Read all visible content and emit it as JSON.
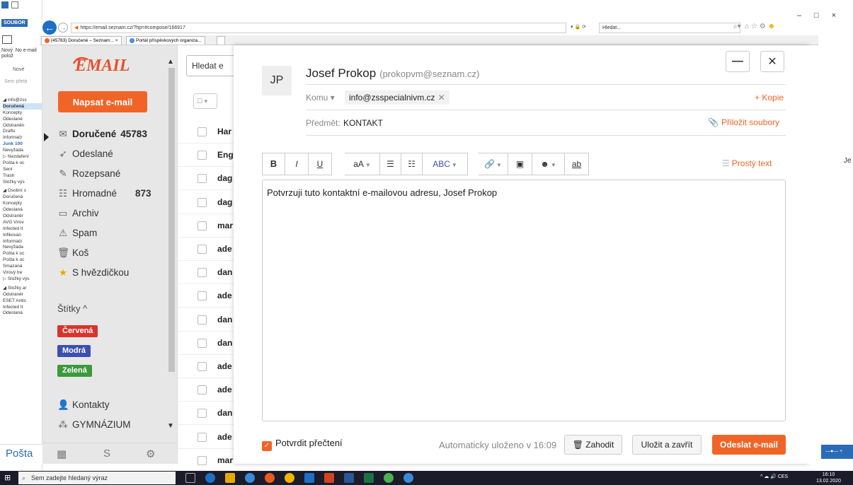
{
  "outlook": {
    "ribbon_tab": "SOUBOR",
    "new_label": "Nový  No e-mail polož",
    "new_category": "Nové",
    "search_hint": "Sem přetá",
    "folders": [
      {
        "label": "◢ info@zss",
        "kind": "acc"
      },
      {
        "label": "Doručená",
        "kind": "sel"
      },
      {
        "label": "Koncepty",
        "kind": ""
      },
      {
        "label": "Odeslané",
        "kind": ""
      },
      {
        "label": "Odstraněn",
        "kind": ""
      },
      {
        "label": "Drafts",
        "kind": ""
      },
      {
        "label": "Informačr",
        "kind": ""
      },
      {
        "label": "Junk 100",
        "kind": "blue"
      },
      {
        "label": "Nevyžáda",
        "kind": ""
      },
      {
        "label": "▷ Nezdaření",
        "kind": ""
      },
      {
        "label": "Pošta k oc",
        "kind": ""
      },
      {
        "label": "Sent",
        "kind": ""
      },
      {
        "label": "Trash",
        "kind": ""
      },
      {
        "label": "Složky výs",
        "kind": ""
      },
      {
        "label": "◢ Osobní s",
        "kind": "acc"
      },
      {
        "label": "Doručená",
        "kind": ""
      },
      {
        "label": "Koncepty",
        "kind": ""
      },
      {
        "label": "Odeslaná",
        "kind": ""
      },
      {
        "label": "Odstraněr",
        "kind": ""
      },
      {
        "label": "AVG Virov",
        "kind": ""
      },
      {
        "label": "Infected It",
        "kind": ""
      },
      {
        "label": "Infikovan",
        "kind": ""
      },
      {
        "label": "Informačr",
        "kind": ""
      },
      {
        "label": "Nevyžáda",
        "kind": ""
      },
      {
        "label": "Pošta k oc",
        "kind": ""
      },
      {
        "label": "Pošta k oc",
        "kind": ""
      },
      {
        "label": "Smazaná",
        "kind": ""
      },
      {
        "label": "Virový tre",
        "kind": ""
      },
      {
        "label": "▷ Složky výs",
        "kind": ""
      },
      {
        "label": "◢ Složky ar",
        "kind": "acc"
      },
      {
        "label": "Odstraněr",
        "kind": ""
      },
      {
        "label": "ESET Antis",
        "kind": ""
      },
      {
        "label": "Infected It",
        "kind": ""
      },
      {
        "label": "Odeslaná",
        "kind": ""
      }
    ],
    "posta_label": "Pošta"
  },
  "browser": {
    "url": "https://email.seznam.cz/?hp=#compose/166917",
    "search_placeholder": "Hledat...",
    "url_tools": "▾ 🔒 ⟳",
    "tabs": [
      {
        "label": "(45783) Doručené – Seznam... ×",
        "fav_color": "#f06527"
      },
      {
        "label": "Portál příspěvkových organiza...",
        "fav_color": "#4a90d9"
      }
    ]
  },
  "nav": {
    "logo_text": "EMAIL",
    "compose_label": "Napsat e-mail",
    "items": [
      {
        "icon": "✉",
        "label": "Doručené",
        "count": "45783",
        "bold": true
      },
      {
        "icon": "➶",
        "label": "Odeslané",
        "count": "",
        "bold": false
      },
      {
        "icon": "✎",
        "label": "Rozepsané",
        "count": "",
        "bold": false
      },
      {
        "icon": "☷",
        "label": "Hromadné",
        "count": "873",
        "bold": false
      },
      {
        "icon": "▭",
        "label": "Archiv",
        "count": "",
        "bold": false
      },
      {
        "icon": "⚠",
        "label": "Spam",
        "count": "",
        "bold": false
      },
      {
        "icon": "🗑",
        "label": "Koš",
        "count": "",
        "bold": false
      },
      {
        "icon": "★",
        "label": "S hvězdičkou",
        "count": "",
        "bold": false
      }
    ],
    "labels_title": "Štítky ^",
    "labels": [
      {
        "label": "Červená",
        "color": "#d9342b"
      },
      {
        "label": "Modrá",
        "color": "#3a4fb0"
      },
      {
        "label": "Zelená",
        "color": "#3c9a3c"
      }
    ],
    "contacts": "Kontakty",
    "group": "GYMNÁZIUM"
  },
  "list": {
    "search_text": "Hledat e",
    "rows": [
      "Har",
      "Eng",
      "dag",
      "dag",
      "mar",
      "ade",
      "dan",
      "ade",
      "dan",
      "dan",
      "ade",
      "ade",
      "dan",
      "ade",
      "mar"
    ]
  },
  "compose": {
    "avatar": "JP",
    "sender_name": "Josef Prokop",
    "sender_email": "(prokopvm@seznam.cz)",
    "to_label": "Komu ▾",
    "to_recipient": "info@zsspecialnivm.cz",
    "copy_label": "+ Kopie",
    "subject_label": "Předmět:",
    "subject_value": "KONTAKT",
    "attach_label": "Přiložit soubory",
    "plain_text_label": "Prostý text",
    "body": "Potvrzuji tuto kontaktní e-mailovou adresu, Josef Prokop",
    "confirm_label": "Potvrdit přečtení",
    "autosave": "Automaticky uloženo v 16:09",
    "discard_label": "Zahodit",
    "save_close_label": "Uložit a zavřít",
    "send_label": "Odeslat e-mail",
    "accent": "#f06527"
  },
  "toolbar": {
    "bold": "B",
    "italic": "I",
    "underline": "U",
    "font_size": "aA",
    "ordered_list": "☰",
    "bullet_list": "☷",
    "spellcheck": "ABC",
    "link": "🔗",
    "image": "▣",
    "emoji": "☻",
    "clear_format": "ab"
  },
  "right": {
    "je": "Je"
  },
  "taskbar": {
    "search_placeholder": "Sem zadejte hledaný výraz",
    "tray": "^ ☁ 🔊 CES",
    "time": "16:10",
    "date": "13.02.2020"
  }
}
